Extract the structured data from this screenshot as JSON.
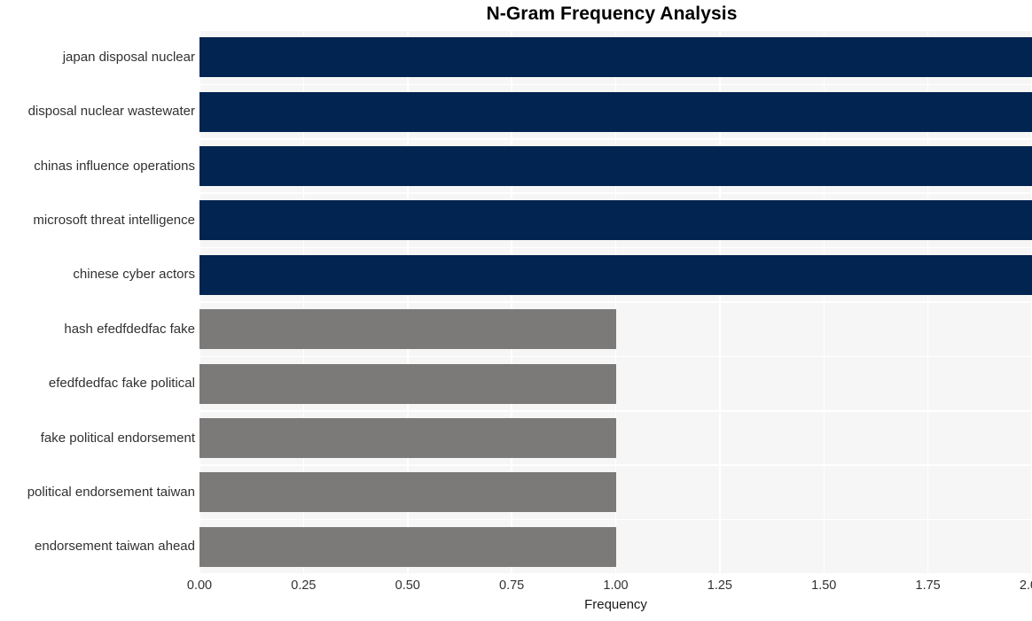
{
  "chart_data": {
    "type": "bar",
    "orientation": "horizontal",
    "title": "N-Gram Frequency Analysis",
    "xlabel": "Frequency",
    "ylabel": "",
    "xlim": [
      0,
      2
    ],
    "xticks": [
      "0.00",
      "0.25",
      "0.50",
      "0.75",
      "1.00",
      "1.25",
      "1.50",
      "1.75",
      "2.00"
    ],
    "xtick_values": [
      0,
      0.25,
      0.5,
      0.75,
      1.0,
      1.25,
      1.5,
      1.75,
      2.0
    ],
    "grid": true,
    "legend": "none",
    "categories": [
      "japan disposal nuclear",
      "disposal nuclear wastewater",
      "chinas influence operations",
      "microsoft threat intelligence",
      "chinese cyber actors",
      "hash efedfdedfac fake",
      "efedfdedfac fake political",
      "fake political endorsement",
      "political endorsement taiwan",
      "endorsement taiwan ahead"
    ],
    "values": [
      2,
      2,
      2,
      2,
      2,
      1,
      1,
      1,
      1,
      1
    ],
    "bar_colors": [
      "#022450",
      "#022450",
      "#022450",
      "#022450",
      "#022450",
      "#7b7a78",
      "#7b7a78",
      "#7b7a78",
      "#7b7a78",
      "#7b7a78"
    ],
    "colors": {
      "high": "#022450",
      "low": "#7b7a78",
      "plot_background": "#f6f6f6",
      "gridline": "#ffffff",
      "figure_background": "#ffffff",
      "title": "#000000",
      "tick_label": "#313131"
    }
  }
}
